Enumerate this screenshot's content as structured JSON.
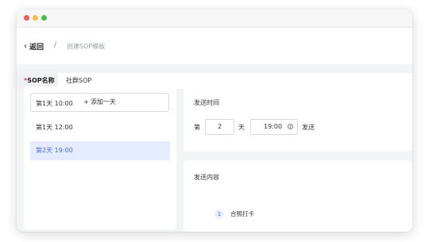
{
  "header": {
    "back_label": "返回",
    "separator": "/",
    "breadcrumb": "创建SOP模板"
  },
  "sop_name": {
    "required_mark": "*",
    "label": "SOP名称",
    "value": "社群SOP"
  },
  "days": [
    {
      "label": "第1天 10:00",
      "active": false
    },
    {
      "label": "第1天 12:00",
      "active": false
    },
    {
      "label": "第2天 19:00",
      "active": true
    }
  ],
  "add_day": {
    "icon": "plus-icon",
    "label": "添加一天"
  },
  "send_time": {
    "title": "发送时间",
    "prefix": "第",
    "day_value": "2",
    "day_unit": "天",
    "time_value": "19:00",
    "time_icon": "clock-icon",
    "suffix": "发送"
  },
  "send_content": {
    "title": "发送内容",
    "items": [
      {
        "index": "1",
        "text": "合照打卡"
      }
    ]
  },
  "colors": {
    "accent": "#4a6cf7",
    "active_bg": "#e6ecff",
    "required": "#e53935",
    "window_bg": "#f3f4f6"
  }
}
